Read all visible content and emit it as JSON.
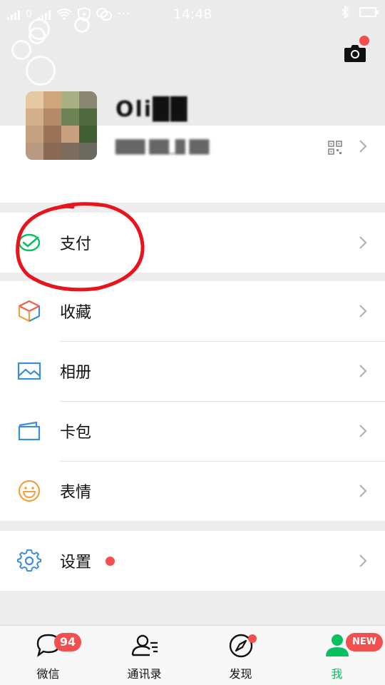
{
  "status_bar": {
    "time": "14:48",
    "more": "···"
  },
  "profile": {
    "name": "Oli██",
    "wechat_id": "███ ██_█ ██"
  },
  "menu": {
    "pay": "支付",
    "favorites": "收藏",
    "album": "相册",
    "cards": "卡包",
    "stickers": "表情",
    "settings": "设置"
  },
  "tabs": [
    {
      "label": "微信",
      "badge": "94"
    },
    {
      "label": "通讯录"
    },
    {
      "label": "发现"
    },
    {
      "label": "我",
      "badge": "NEW"
    }
  ],
  "colors": {
    "accent_green": "#07c160",
    "badge_red": "#f25050",
    "annotation_red": "#e8141c",
    "icon_blue": "#3b8de0",
    "icon_orange": "#f5a03b"
  },
  "icons": {
    "camera": "camera-icon",
    "qr": "qr-code-icon",
    "pay": "wallet-check-icon",
    "favorites": "cube-icon",
    "album": "picture-icon",
    "cards": "card-wallet-icon",
    "stickers": "smiley-icon",
    "settings": "gear-icon"
  }
}
